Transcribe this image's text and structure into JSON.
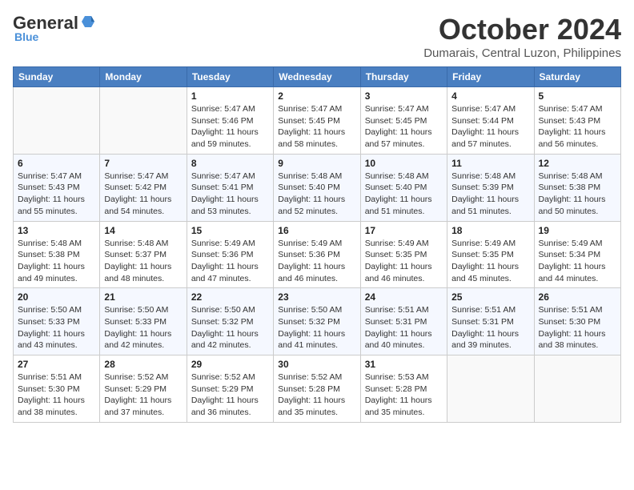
{
  "header": {
    "logo_general": "General",
    "logo_blue": "Blue",
    "month_title": "October 2024",
    "location": "Dumarais, Central Luzon, Philippines"
  },
  "weekdays": [
    "Sunday",
    "Monday",
    "Tuesday",
    "Wednesday",
    "Thursday",
    "Friday",
    "Saturday"
  ],
  "weeks": [
    [
      {
        "day": "",
        "sunrise": "",
        "sunset": "",
        "daylight": ""
      },
      {
        "day": "",
        "sunrise": "",
        "sunset": "",
        "daylight": ""
      },
      {
        "day": "1",
        "sunrise": "Sunrise: 5:47 AM",
        "sunset": "Sunset: 5:46 PM",
        "daylight": "Daylight: 11 hours and 59 minutes."
      },
      {
        "day": "2",
        "sunrise": "Sunrise: 5:47 AM",
        "sunset": "Sunset: 5:45 PM",
        "daylight": "Daylight: 11 hours and 58 minutes."
      },
      {
        "day": "3",
        "sunrise": "Sunrise: 5:47 AM",
        "sunset": "Sunset: 5:45 PM",
        "daylight": "Daylight: 11 hours and 57 minutes."
      },
      {
        "day": "4",
        "sunrise": "Sunrise: 5:47 AM",
        "sunset": "Sunset: 5:44 PM",
        "daylight": "Daylight: 11 hours and 57 minutes."
      },
      {
        "day": "5",
        "sunrise": "Sunrise: 5:47 AM",
        "sunset": "Sunset: 5:43 PM",
        "daylight": "Daylight: 11 hours and 56 minutes."
      }
    ],
    [
      {
        "day": "6",
        "sunrise": "Sunrise: 5:47 AM",
        "sunset": "Sunset: 5:43 PM",
        "daylight": "Daylight: 11 hours and 55 minutes."
      },
      {
        "day": "7",
        "sunrise": "Sunrise: 5:47 AM",
        "sunset": "Sunset: 5:42 PM",
        "daylight": "Daylight: 11 hours and 54 minutes."
      },
      {
        "day": "8",
        "sunrise": "Sunrise: 5:47 AM",
        "sunset": "Sunset: 5:41 PM",
        "daylight": "Daylight: 11 hours and 53 minutes."
      },
      {
        "day": "9",
        "sunrise": "Sunrise: 5:48 AM",
        "sunset": "Sunset: 5:40 PM",
        "daylight": "Daylight: 11 hours and 52 minutes."
      },
      {
        "day": "10",
        "sunrise": "Sunrise: 5:48 AM",
        "sunset": "Sunset: 5:40 PM",
        "daylight": "Daylight: 11 hours and 51 minutes."
      },
      {
        "day": "11",
        "sunrise": "Sunrise: 5:48 AM",
        "sunset": "Sunset: 5:39 PM",
        "daylight": "Daylight: 11 hours and 51 minutes."
      },
      {
        "day": "12",
        "sunrise": "Sunrise: 5:48 AM",
        "sunset": "Sunset: 5:38 PM",
        "daylight": "Daylight: 11 hours and 50 minutes."
      }
    ],
    [
      {
        "day": "13",
        "sunrise": "Sunrise: 5:48 AM",
        "sunset": "Sunset: 5:38 PM",
        "daylight": "Daylight: 11 hours and 49 minutes."
      },
      {
        "day": "14",
        "sunrise": "Sunrise: 5:48 AM",
        "sunset": "Sunset: 5:37 PM",
        "daylight": "Daylight: 11 hours and 48 minutes."
      },
      {
        "day": "15",
        "sunrise": "Sunrise: 5:49 AM",
        "sunset": "Sunset: 5:36 PM",
        "daylight": "Daylight: 11 hours and 47 minutes."
      },
      {
        "day": "16",
        "sunrise": "Sunrise: 5:49 AM",
        "sunset": "Sunset: 5:36 PM",
        "daylight": "Daylight: 11 hours and 46 minutes."
      },
      {
        "day": "17",
        "sunrise": "Sunrise: 5:49 AM",
        "sunset": "Sunset: 5:35 PM",
        "daylight": "Daylight: 11 hours and 46 minutes."
      },
      {
        "day": "18",
        "sunrise": "Sunrise: 5:49 AM",
        "sunset": "Sunset: 5:35 PM",
        "daylight": "Daylight: 11 hours and 45 minutes."
      },
      {
        "day": "19",
        "sunrise": "Sunrise: 5:49 AM",
        "sunset": "Sunset: 5:34 PM",
        "daylight": "Daylight: 11 hours and 44 minutes."
      }
    ],
    [
      {
        "day": "20",
        "sunrise": "Sunrise: 5:50 AM",
        "sunset": "Sunset: 5:33 PM",
        "daylight": "Daylight: 11 hours and 43 minutes."
      },
      {
        "day": "21",
        "sunrise": "Sunrise: 5:50 AM",
        "sunset": "Sunset: 5:33 PM",
        "daylight": "Daylight: 11 hours and 42 minutes."
      },
      {
        "day": "22",
        "sunrise": "Sunrise: 5:50 AM",
        "sunset": "Sunset: 5:32 PM",
        "daylight": "Daylight: 11 hours and 42 minutes."
      },
      {
        "day": "23",
        "sunrise": "Sunrise: 5:50 AM",
        "sunset": "Sunset: 5:32 PM",
        "daylight": "Daylight: 11 hours and 41 minutes."
      },
      {
        "day": "24",
        "sunrise": "Sunrise: 5:51 AM",
        "sunset": "Sunset: 5:31 PM",
        "daylight": "Daylight: 11 hours and 40 minutes."
      },
      {
        "day": "25",
        "sunrise": "Sunrise: 5:51 AM",
        "sunset": "Sunset: 5:31 PM",
        "daylight": "Daylight: 11 hours and 39 minutes."
      },
      {
        "day": "26",
        "sunrise": "Sunrise: 5:51 AM",
        "sunset": "Sunset: 5:30 PM",
        "daylight": "Daylight: 11 hours and 38 minutes."
      }
    ],
    [
      {
        "day": "27",
        "sunrise": "Sunrise: 5:51 AM",
        "sunset": "Sunset: 5:30 PM",
        "daylight": "Daylight: 11 hours and 38 minutes."
      },
      {
        "day": "28",
        "sunrise": "Sunrise: 5:52 AM",
        "sunset": "Sunset: 5:29 PM",
        "daylight": "Daylight: 11 hours and 37 minutes."
      },
      {
        "day": "29",
        "sunrise": "Sunrise: 5:52 AM",
        "sunset": "Sunset: 5:29 PM",
        "daylight": "Daylight: 11 hours and 36 minutes."
      },
      {
        "day": "30",
        "sunrise": "Sunrise: 5:52 AM",
        "sunset": "Sunset: 5:28 PM",
        "daylight": "Daylight: 11 hours and 35 minutes."
      },
      {
        "day": "31",
        "sunrise": "Sunrise: 5:53 AM",
        "sunset": "Sunset: 5:28 PM",
        "daylight": "Daylight: 11 hours and 35 minutes."
      },
      {
        "day": "",
        "sunrise": "",
        "sunset": "",
        "daylight": ""
      },
      {
        "day": "",
        "sunrise": "",
        "sunset": "",
        "daylight": ""
      }
    ]
  ]
}
